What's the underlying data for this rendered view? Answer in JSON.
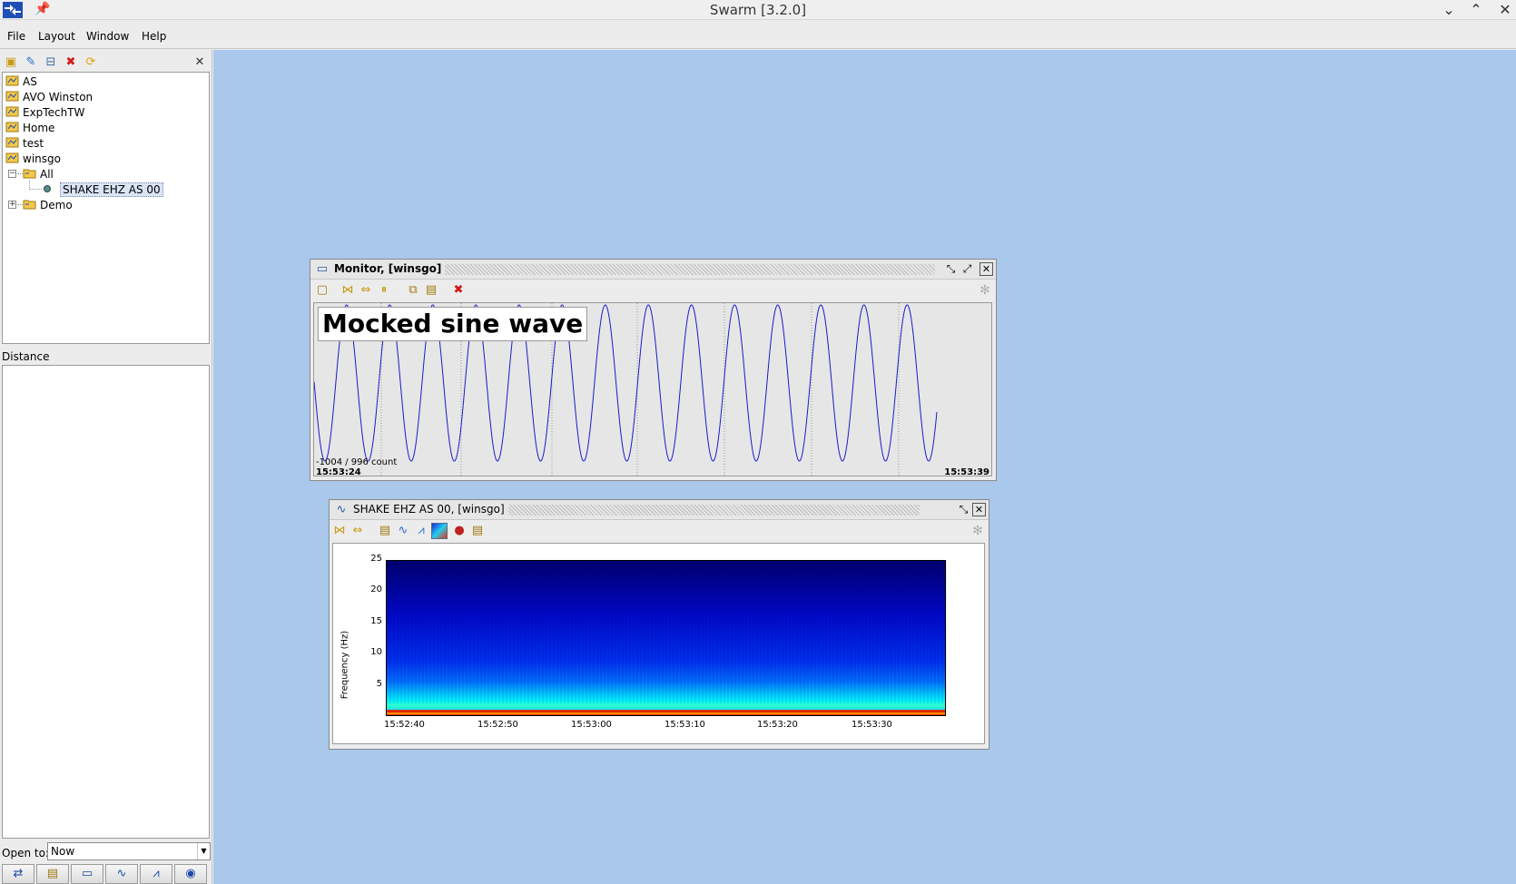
{
  "window": {
    "title": "Swarm [3.2.0]"
  },
  "menu": {
    "items": [
      {
        "label": "File"
      },
      {
        "label": "Layout"
      },
      {
        "label": "Window"
      },
      {
        "label": "Help"
      }
    ]
  },
  "tree": {
    "items": [
      {
        "label": "AS"
      },
      {
        "label": "AVO Winston"
      },
      {
        "label": "ExpTechTW"
      },
      {
        "label": "Home"
      },
      {
        "label": "test"
      },
      {
        "label": "winsgo"
      }
    ],
    "folder_all": "All",
    "channel": "SHAKE EHZ AS 00",
    "folder_demo": "Demo"
  },
  "distance": {
    "label": "Distance"
  },
  "open_to": {
    "label": "Open to:",
    "value": "Now"
  },
  "monitor": {
    "title": "Monitor, [winsgo]",
    "label": "Mocked sine wave",
    "range": "-1004 / 996 count",
    "start_time": "15:53:24",
    "end_time": "15:53:39"
  },
  "spectrogram": {
    "title": "SHAKE EHZ AS 00, [winsgo]"
  },
  "chart_data": {
    "type": "heatmap",
    "ylabel": "Frequency (Hz)",
    "xlabel": "",
    "y_ticks": [
      "25",
      "20",
      "15",
      "10",
      "5"
    ],
    "x_ticks": [
      "15:52:40",
      "15:52:50",
      "15:53:00",
      "15:53:10",
      "15:53:20",
      "15:53:30"
    ],
    "ylim": [
      0,
      25
    ],
    "dominant_band_hz": [
      0,
      1
    ],
    "colors": {
      "low": "#0000c8",
      "mid": "#00d8ff",
      "high": "#e02800"
    }
  },
  "colors": {
    "desktop": "#a9c8ec",
    "waveform": "#1a1acc"
  }
}
